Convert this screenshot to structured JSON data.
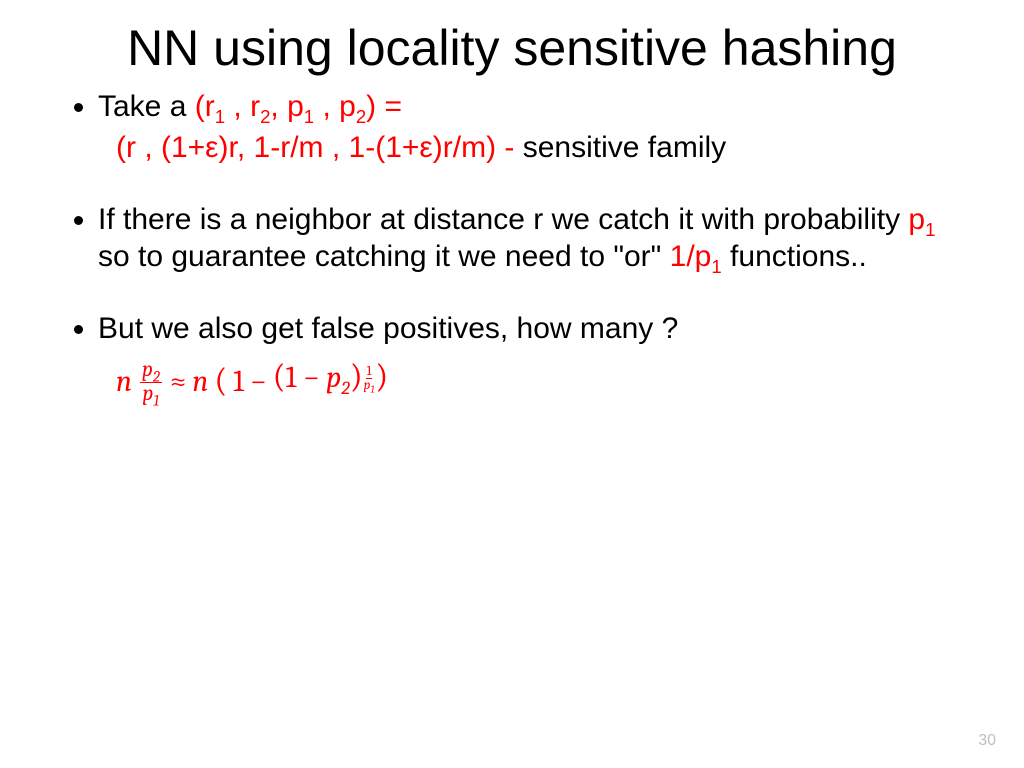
{
  "title": "NN using locality sensitive hashing",
  "bullet1": {
    "lead": "Take a ",
    "params_open": "(r",
    "sub1": "1",
    "comma1": " , r",
    "sub2": "2",
    "comma2": ", p",
    "sub3": "1",
    "comma3": " , p",
    "sub4": "2",
    "params_close": ") = ",
    "line2_red": "(r , (1+ε)r, 1-r/m , 1-(1+ε)r/m) - ",
    "line2_black": "sensitive family"
  },
  "bullet2": {
    "part1": "If there is a neighbor at distance r we catch it with probability ",
    "p1": "p",
    "p1_sub": "1",
    "part2": " so to guarantee catching it we need to \"or\" ",
    "oneoverp": "1/p",
    "oneoverp_sub": "1",
    "part3": " functions.."
  },
  "bullet3": {
    "text": "But we also get false positives, how many ?"
  },
  "equation": {
    "n1": "n",
    "frac_top_p": "p",
    "frac_top_sub": "2",
    "frac_bot_p": "p",
    "frac_bot_sub": "1",
    "approx": "≈",
    "n2": "n",
    "open1": "(",
    "one": "1",
    "minus1": "−",
    "open2": "(",
    "one2": "1",
    "minus2": "−",
    "p2": "p",
    "p2_sub": "2",
    "close2": ")",
    "exp_top": "1",
    "exp_bot_p": "p",
    "exp_bot_sub": "1",
    "close1": ")"
  },
  "pageno": "30"
}
